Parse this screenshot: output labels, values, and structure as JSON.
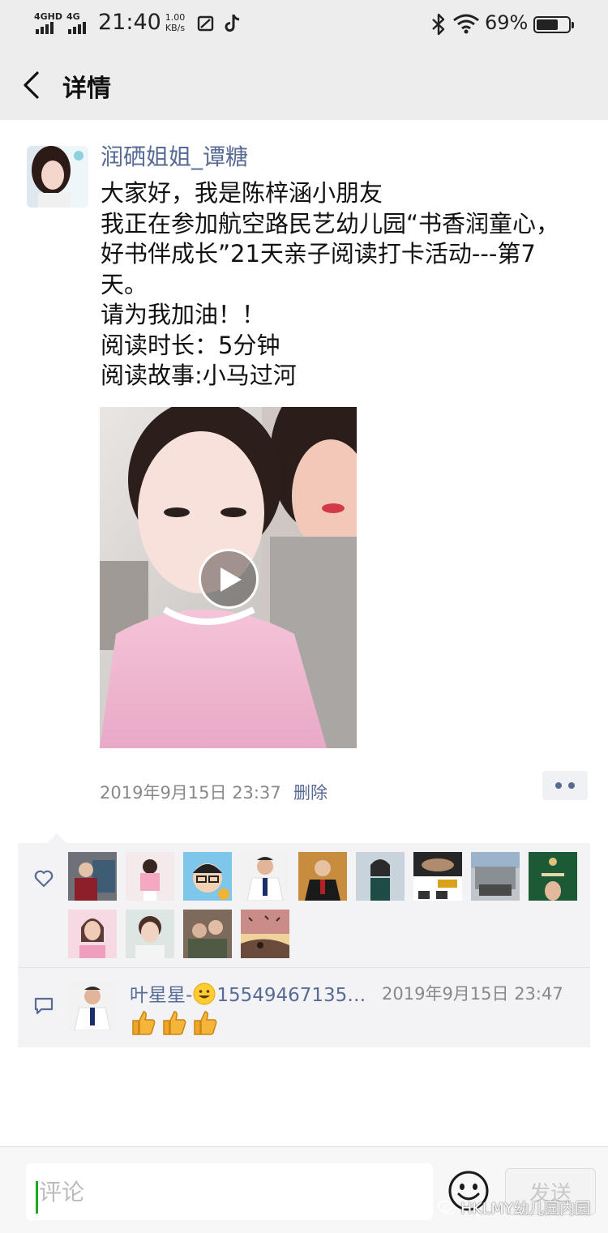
{
  "status_bar": {
    "signal1_label": "4GHD",
    "signal2_label": "4G",
    "time": "21:40",
    "net_speed_value": "1.00",
    "net_speed_unit": "KB/s",
    "battery_percent": "69%",
    "battery_level": 0.69
  },
  "header": {
    "title": "详情"
  },
  "post": {
    "author": "润硒姐姐_谭糖",
    "text_lines": [
      "大家好，我是陈梓涵小朋友",
      "我正在参加航空路民艺幼儿园“书香润童心，好书伴成长”21天亲子阅读打卡活动---第7天。",
      "请为我加油！！",
      "阅读时长：5分钟",
      "阅读故事:小马过河"
    ],
    "timestamp": "2019年9月15日 23:37",
    "delete_label": "删除"
  },
  "comment": {
    "author_prefix": "叶星星-",
    "author_suffix": "15549467135…",
    "time": "2019年9月15日 23:47"
  },
  "input_bar": {
    "placeholder": "评论",
    "send_label": "发送"
  },
  "watermark": "HKLMY幼儿园内园",
  "colors": {
    "link_blue": "#576b95",
    "header_bg": "#ededed",
    "interact_bg": "#f3f3f5"
  }
}
